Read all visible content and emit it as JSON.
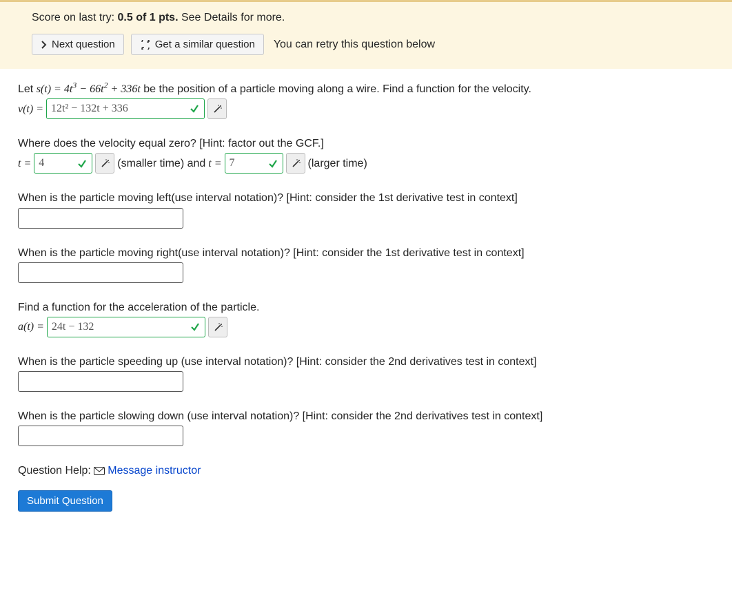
{
  "score_panel": {
    "score_prefix": "Score on last try: ",
    "score_value": "0.5 of 1 pts.",
    "see_details": " See Details for more.",
    "next_question_label": "Next question",
    "similar_question_label": "Get a similar question",
    "retry_text": "You can retry this question below"
  },
  "question": {
    "intro_pre": "Let ",
    "position_expr": "s(t) = 4t³ − 66t² + 336t",
    "intro_post": " be the position of a particle moving along a wire. Find a function for the velocity.",
    "velocity_label": "v(t) = ",
    "velocity_value": "12t² − 132t + 336",
    "zero_vel_prompt": "Where does the velocity equal zero? [Hint: factor out the GCF.]",
    "t_eq": "t = ",
    "t1_value": "4",
    "t1_tag": " (smaller time) and ",
    "t2_value": "7",
    "t2_tag": " (larger time)",
    "moving_left_prompt": "When is the particle moving left(use interval notation)? [Hint: consider the 1st derivative test in context]",
    "moving_right_prompt": "When is the particle moving right(use interval notation)? [Hint: consider the 1st derivative test in context]",
    "accel_prompt": "Find a function for the acceleration of the particle.",
    "accel_label": "a(t) = ",
    "accel_value": "24t − 132",
    "speeding_up_prompt": "When is the particle speeding up (use interval notation)? [Hint: consider the 2nd derivatives test in context]",
    "slowing_down_prompt": "When is the particle slowing down (use interval notation)? [Hint: consider the 2nd derivatives test in context]",
    "help_label": "Question Help: ",
    "message_instructor": "Message instructor",
    "submit_label": "Submit Question"
  }
}
